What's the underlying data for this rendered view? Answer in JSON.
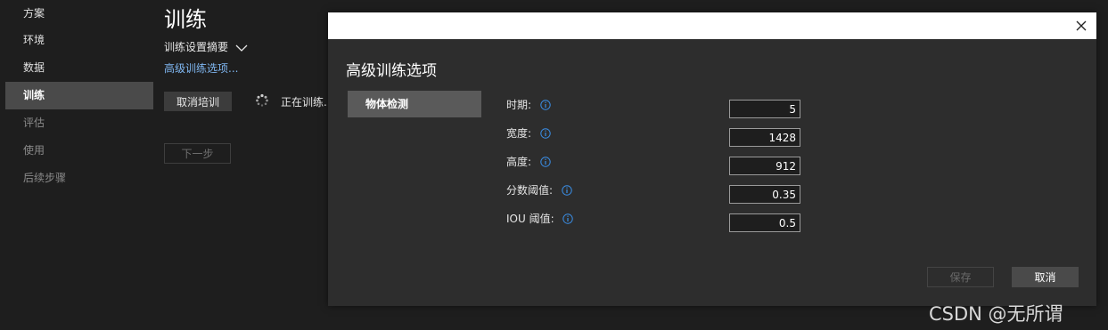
{
  "sidebar": {
    "items": [
      {
        "label": "方案"
      },
      {
        "label": "环境"
      },
      {
        "label": "数据"
      },
      {
        "label": "训练"
      },
      {
        "label": "评估"
      },
      {
        "label": "使用"
      },
      {
        "label": "后续步骤"
      }
    ]
  },
  "main": {
    "title": "训练",
    "summary_label": "训练设置摘要",
    "advanced_link": "高级训练选项...",
    "cancel_training_label": "取消培训",
    "status_text": "正在训练..",
    "next_label": "下一步"
  },
  "dialog": {
    "title": "高级训练选项",
    "tab_label": "物体检测",
    "fields": [
      {
        "label": "时期:",
        "value": "5"
      },
      {
        "label": "宽度:",
        "value": "1428"
      },
      {
        "label": "高度:",
        "value": "912"
      },
      {
        "label": "分数阈值:",
        "value": "0.35"
      },
      {
        "label": "IOU 阈值:",
        "value": "0.5"
      }
    ],
    "save_label": "保存",
    "cancel_label": "取消"
  },
  "watermark": "CSDN @无所谓",
  "colors": {
    "background": "#1e1e1e",
    "dialog": "#2d2d2d",
    "active_nav": "#4a4a4a",
    "link": "#7fb6f0",
    "info_icon": "#3a8ee6"
  }
}
